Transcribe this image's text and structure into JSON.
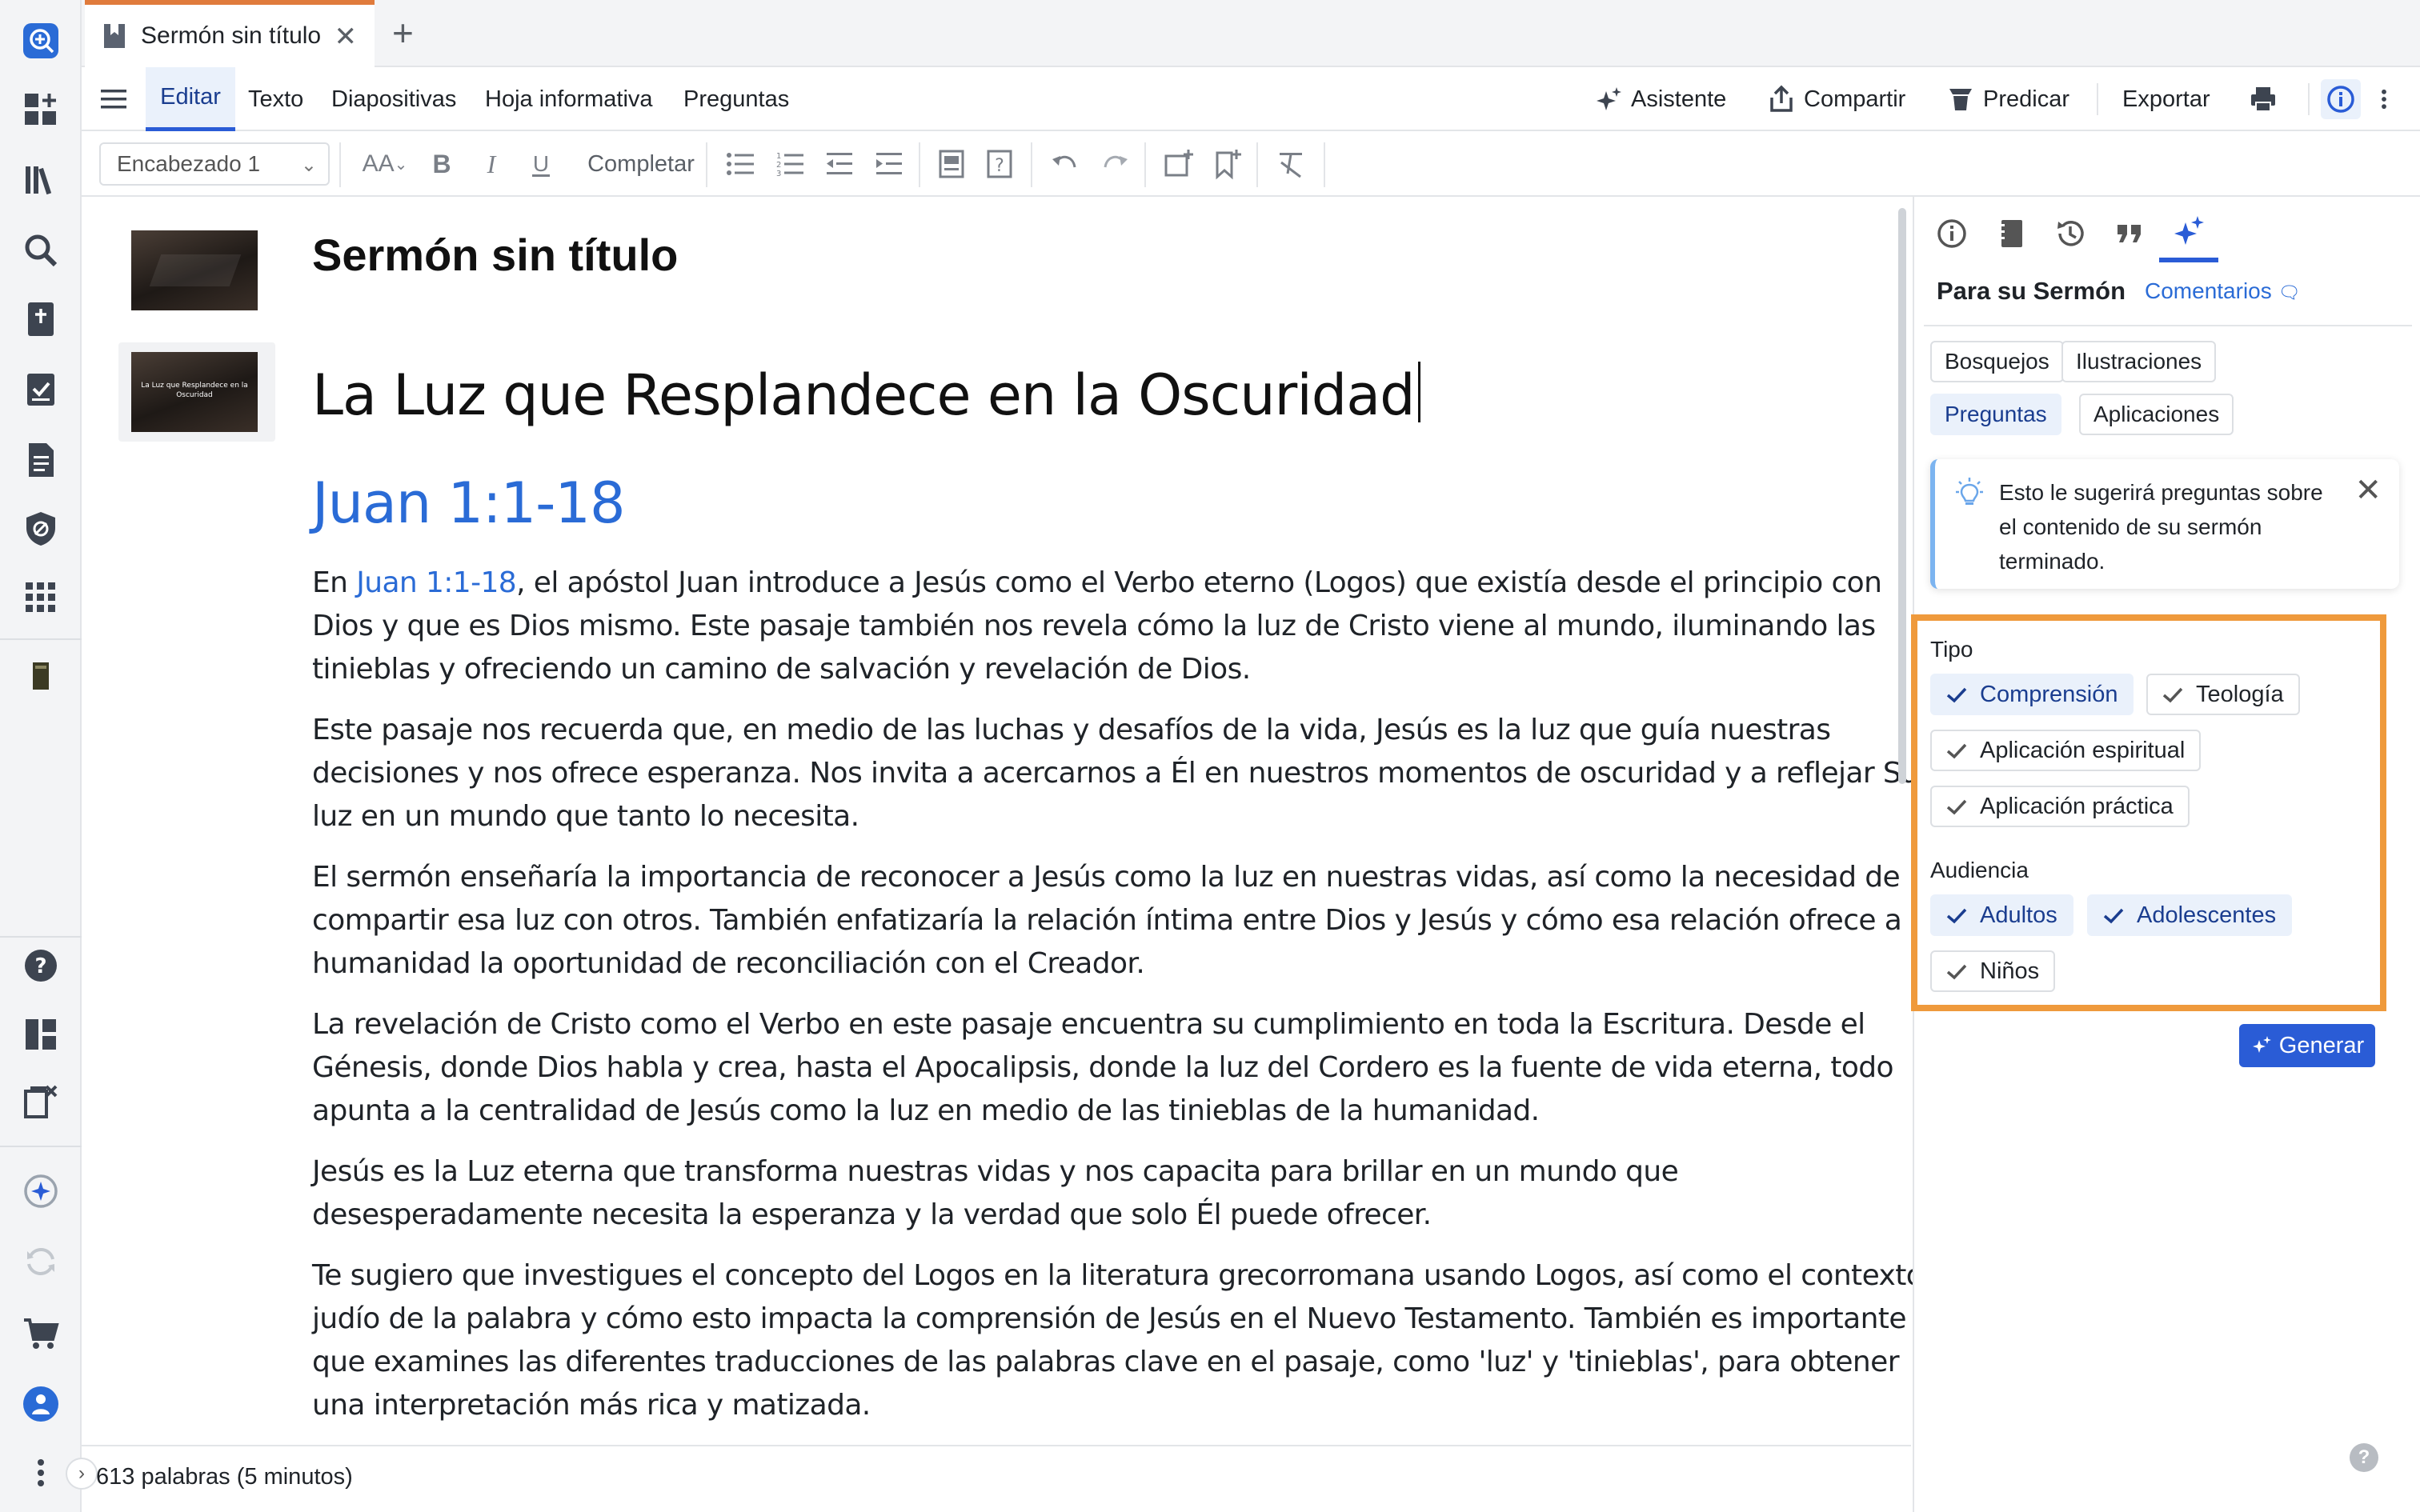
{
  "tab": {
    "title": "Sermón sin título",
    "close": "✕",
    "add": "+"
  },
  "menu": {
    "items": [
      "Editar",
      "Texto",
      "Diapositivas",
      "Hoja informativa",
      "Preguntas"
    ],
    "asistente": "Asistente",
    "compartir": "Compartir",
    "predicar": "Predicar",
    "exportar": "Exportar"
  },
  "toolbar": {
    "style": "Encabezado 1",
    "completar": "Completar",
    "font_size_glyph": "AA"
  },
  "document": {
    "title": "Sermón sin título",
    "heading": "La Luz que Resplandece en la Oscuridad",
    "thumb_caption": "La Luz que Resplandece en la Oscuridad",
    "passage": "Juan 1:1-18",
    "p1_before": "En ",
    "p1_link": "Juan 1:1-18",
    "p1_after": ", el apóstol Juan introduce a Jesús como el Verbo eterno (Logos) que existía desde el principio con Dios y que es Dios mismo. Este pasaje también nos revela cómo la luz de Cristo viene al mundo, iluminando las tinieblas y ofreciendo un camino de salvación y revelación de Dios.",
    "p2": "Este pasaje nos recuerda que, en medio de las luchas y desafíos de la vida, Jesús es la luz que guía nuestras decisiones y nos ofrece esperanza. Nos invita a acercarnos a Él en nuestros momentos de oscuridad y a reflejar Su luz en un mundo que tanto lo necesita.",
    "p3": "El sermón enseñaría la importancia de reconocer a Jesús como la luz en nuestras vidas, así como la necesidad de compartir esa luz con otros. También enfatizaría la relación íntima entre Dios y Jesús y cómo esa relación ofrece a la humanidad la oportunidad de reconciliación con el Creador.",
    "p4": "La revelación de Cristo como el Verbo en este pasaje encuentra su cumplimiento en toda la Escritura. Desde el Génesis, donde Dios habla y crea, hasta el Apocalipsis, donde la luz del Cordero es la fuente de vida eterna, todo apunta a la centralidad de Jesús como la luz en medio de las tinieblas de la humanidad.",
    "p5": "Jesús es la Luz eterna que transforma nuestras vidas y nos capacita para brillar en un mundo que desesperadamente necesita la esperanza y la verdad que solo Él puede ofrecer.",
    "p6": "Te sugiero que investigues el concepto del Logos en la literatura grecorromana usando Logos, así como el contexto judío de la palabra y cómo esto impacta la comprensión de Jesús en el Nuevo Testamento. También es importante que examines las diferentes traducciones de las palabras clave en el pasaje, como 'luz' y 'tinieblas', para obtener una interpretación más rica y matizada."
  },
  "status": {
    "words": "613 palabras (5 minutos)",
    "collapse": "›"
  },
  "panel": {
    "heading": "Para su Sermón",
    "comments": "Comentarios",
    "categories": [
      "Bosquejos",
      "Ilustraciones",
      "Preguntas",
      "Aplicaciones"
    ],
    "selected_category": "Preguntas",
    "info_text": "Esto le sugerirá preguntas sobre el contenido de su sermón terminado.",
    "info_close": "✕",
    "tipo_label": "Tipo",
    "tipo": [
      {
        "label": "Comprensión",
        "selected": true
      },
      {
        "label": "Teología",
        "selected": false
      },
      {
        "label": "Aplicación espiritual",
        "selected": false
      },
      {
        "label": "Aplicación práctica",
        "selected": false
      }
    ],
    "audiencia_label": "Audiencia",
    "audiencia": [
      {
        "label": "Adultos",
        "selected": true
      },
      {
        "label": "Adolescentes",
        "selected": true
      },
      {
        "label": "Niños",
        "selected": false
      }
    ],
    "generate": "Generar",
    "help": "?"
  },
  "colors": {
    "accent": "#2a5cd6",
    "link": "#2a6bd6",
    "highlight_box": "#ef9a3c",
    "tab_accent": "#e07b3c"
  }
}
